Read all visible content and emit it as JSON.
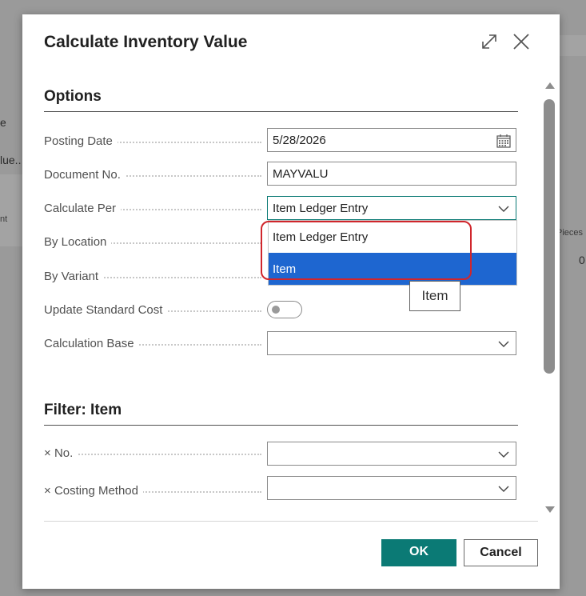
{
  "background": {
    "fragments": [
      "e",
      "lue..",
      "nt",
      "Pieces",
      "0"
    ]
  },
  "dialog": {
    "title": "Calculate Inventory Value",
    "expand_icon": "expand-icon",
    "close_icon": "close-icon"
  },
  "options": {
    "title": "Options",
    "fields": [
      {
        "label": "Posting Date",
        "value": "5/28/2026",
        "icon": "calendar-icon"
      },
      {
        "label": "Document No.",
        "value": "MAYVALU"
      },
      {
        "label": "Calculate Per",
        "value": "Item Ledger Entry"
      },
      {
        "label": "By Location"
      },
      {
        "label": "By Variant"
      },
      {
        "label": "Update Standard Cost",
        "value": false
      },
      {
        "label": "Calculation Base",
        "value": ""
      }
    ]
  },
  "dropdown": {
    "options": [
      "Item Ledger Entry",
      "Item"
    ],
    "selected": "Item"
  },
  "tooltip": {
    "text": "Item"
  },
  "filter": {
    "title": "Filter: Item",
    "fields": [
      {
        "label": "No.",
        "value": ""
      },
      {
        "label": "Costing Method",
        "value": ""
      }
    ],
    "remove_icon": "×"
  },
  "buttons": {
    "ok": "OK",
    "cancel": "Cancel"
  },
  "colors": {
    "accent": "#0b7a75",
    "selected": "#1e66d0",
    "highlight": "#d0262c"
  }
}
